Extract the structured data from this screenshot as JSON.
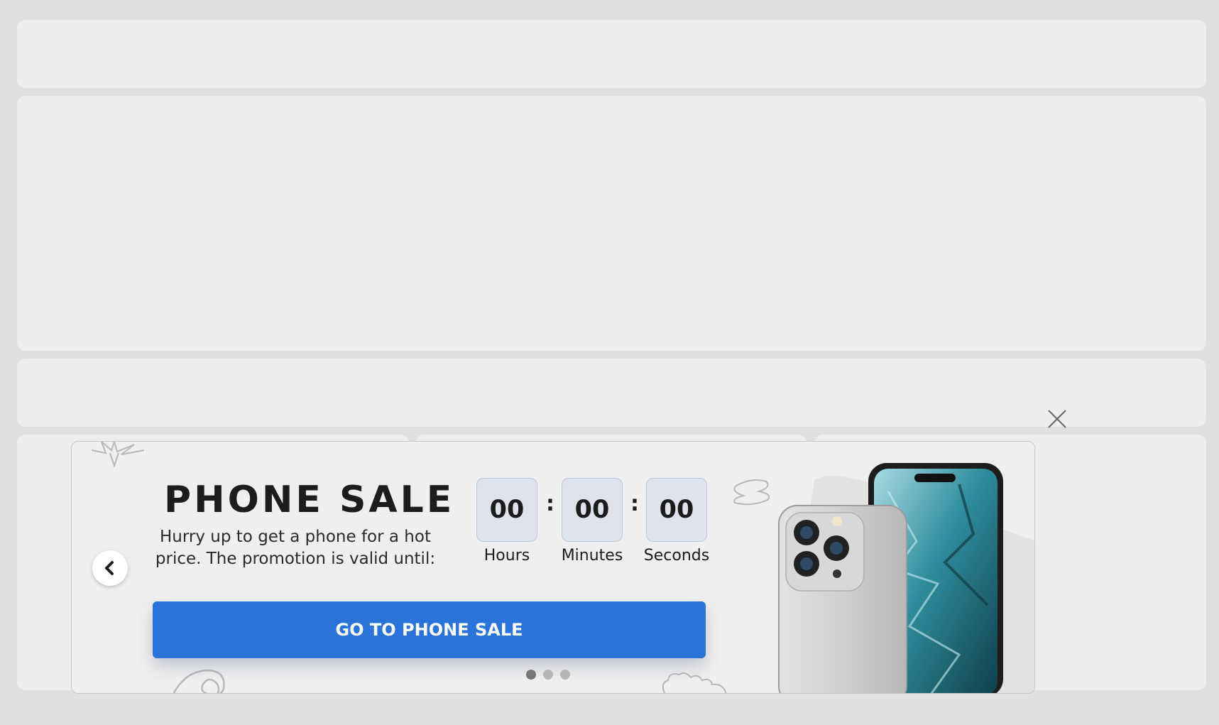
{
  "banner": {
    "title": "PHONE SALE",
    "subtitle": "Hurry up to get a phone for a hot price. The promotion is valid until:",
    "timer": {
      "hours": "00",
      "minutes": "00",
      "seconds": "00",
      "separator": ":",
      "hours_label": "Hours",
      "minutes_label": "Minutes",
      "seconds_label": "Seconds"
    },
    "cta_label": "GO TO PHONE SALE",
    "carousel": {
      "slides": 3,
      "active_slide": 1
    }
  },
  "icons": {
    "close": "close-icon",
    "prev": "chevron-left-icon",
    "next": "chevron-right-icon"
  },
  "colors": {
    "page_background": "#e0e0e0",
    "placeholder_block": "#ededed",
    "banner_background": "#efefef",
    "cta_background": "#2a73d9",
    "timer_box": "#dfe4ec",
    "timer_border": "#b7c6e3",
    "text": "#1c1c1c",
    "dot_active": "#777777",
    "dot_inactive": "#b5b5b5"
  }
}
